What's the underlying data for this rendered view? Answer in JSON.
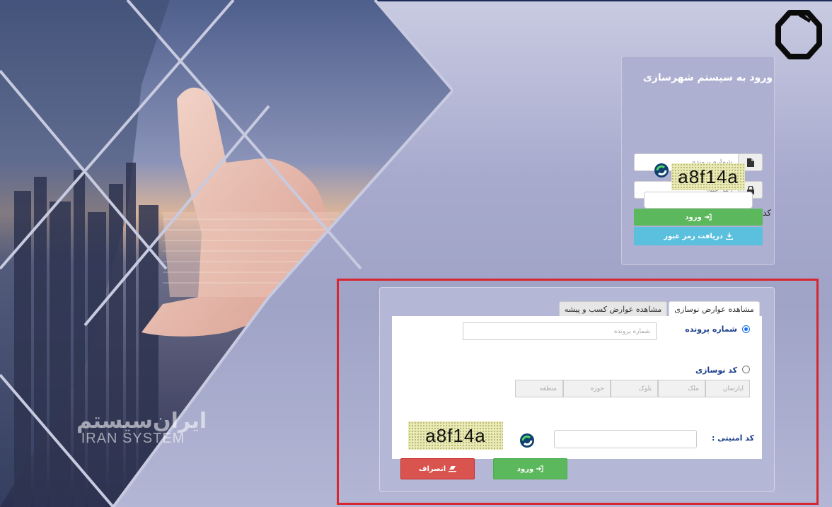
{
  "brand": {
    "name_fa": "ایران‌سیستم",
    "name_en": "IRAN SYSTEM",
    "logo_icon": "octagon-logo-icon"
  },
  "login": {
    "title": "ورود به سیستم شهرسازی",
    "file_number_placeholder": "شماره پرونده",
    "password_placeholder": "رمز عبور",
    "security_code_label": "کد امنیتی",
    "captcha_text": "a8f14a",
    "login_button": "ورود",
    "recover_button": "دریافت رمز عبور"
  },
  "query": {
    "tabs": [
      {
        "label": "مشاهده عوارض نوسازی",
        "active": true
      },
      {
        "label": "مشاهده عوارض کسب و پیشه",
        "active": false
      }
    ],
    "option_file_number": "شماره پرونده",
    "file_number_placeholder": "شماره پرونده",
    "option_renovation_code": "کد نوسازی",
    "code_fields": [
      "منطقه",
      "حوزه",
      "بلوک",
      "ملک",
      "آپارتمان"
    ],
    "security_code_label": "کد امنیتی :",
    "captcha_text": "a8f14a",
    "enter_button": "ورود",
    "cancel_button": "انصراف"
  },
  "colors": {
    "success": "#5cb85c",
    "info": "#5bc0de",
    "danger": "#d9534f",
    "highlight": "#d9262e",
    "accent": "#1a3e8c"
  }
}
